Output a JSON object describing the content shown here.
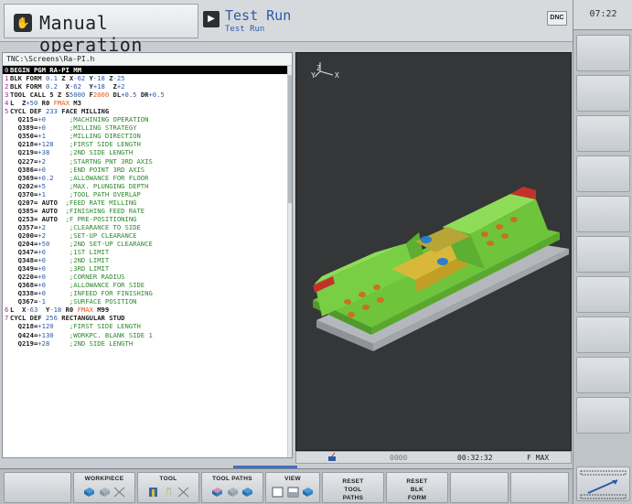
{
  "header": {
    "mode_title": "Manual operation",
    "sub_title": "Test Run",
    "sub_title_small": "Test Run",
    "dnc_label": "DNC",
    "clock": "07:22"
  },
  "program": {
    "path": "TNC:\\Screens\\Ra-PI.h",
    "lines": [
      {
        "n": "0",
        "text": "BEGIN PGM RA-PI MM",
        "selected": true
      },
      {
        "n": "1",
        "html": "BLK FORM <span class='num'>0.1</span> Z X<span class='num'>-62</span> Y<span class='num'>-18</span> Z<span class='num'>-25</span>"
      },
      {
        "n": "2",
        "html": "BLK FORM <span class='num'>0.2</span>  X<span class='num'>-62</span>  Y<span class='num'>+18</span>  Z<span class='num'>+2</span>"
      },
      {
        "n": "3",
        "html": "TOOL CALL 5 Z S<span class='num'>5000</span> F<span class='fmax'>2000</span> DL<span class='num'>+0.5</span> DR<span class='num'>+0.5</span>"
      },
      {
        "n": "4",
        "html": "L  Z<span class='num'>+50</span> R0 <span class='fmax'>FMAX</span> M3"
      },
      {
        "n": "5",
        "html": "CYCL DEF <span class='num'>233</span> FACE MILLING"
      },
      {
        "n": "",
        "html": "  Q215=<span class='num'>+0</span>      <span class='cmt'>;MACHINING OPERATION</span>"
      },
      {
        "n": "",
        "html": "  Q389=<span class='num'>+0</span>      <span class='cmt'>;MILLING STRATEGY</span>"
      },
      {
        "n": "",
        "html": "  Q350=<span class='num'>+1</span>      <span class='cmt'>;MILLING DIRECTION</span>"
      },
      {
        "n": "",
        "html": "  Q218=<span class='num'>+128</span>    <span class='cmt'>;FIRST SIDE LENGTH</span>"
      },
      {
        "n": "",
        "html": "  Q219=<span class='num'>+38</span>     <span class='cmt'>;2ND SIDE LENGTH</span>"
      },
      {
        "n": "",
        "html": "  Q227=<span class='num'>+2</span>      <span class='cmt'>;STARTNG PNT 3RD AXIS</span>"
      },
      {
        "n": "",
        "html": "  Q386=<span class='num'>+0</span>      <span class='cmt'>;END POINT 3RD AXIS</span>"
      },
      {
        "n": "",
        "html": "  Q369=<span class='num'>+0.2</span>    <span class='cmt'>;ALLOWANCE FOR FLOOR</span>"
      },
      {
        "n": "",
        "html": "  Q202=<span class='num'>+5</span>      <span class='cmt'>;MAX. PLUNGING DEPTH</span>"
      },
      {
        "n": "",
        "html": "  Q370=<span class='num'>+1</span>      <span class='cmt'>;TOOL PATH OVERLAP</span>"
      },
      {
        "n": "",
        "html": "  Q207= AUTO  <span class='cmt'>;FEED RATE MILLING</span>"
      },
      {
        "n": "",
        "html": "  Q385= AUTO  <span class='cmt'>;FINISHING FEED RATE</span>"
      },
      {
        "n": "",
        "html": "  Q253= AUTO  <span class='cmt'>;F PRE-POSITIONING</span>"
      },
      {
        "n": "",
        "html": "  Q357=<span class='num'>+2</span>      <span class='cmt'>;CLEARANCE TO SIDE</span>"
      },
      {
        "n": "",
        "html": "  Q200=<span class='num'>+2</span>      <span class='cmt'>;SET-UP CLEARANCE</span>"
      },
      {
        "n": "",
        "html": "  Q204=<span class='num'>+50</span>     <span class='cmt'>;2ND SET-UP CLEARANCE</span>"
      },
      {
        "n": "",
        "html": "  Q347=<span class='num'>+0</span>      <span class='cmt'>;1ST LIMIT</span>"
      },
      {
        "n": "",
        "html": "  Q348=<span class='num'>+0</span>      <span class='cmt'>;2ND LIMIT</span>"
      },
      {
        "n": "",
        "html": "  Q349=<span class='num'>+0</span>      <span class='cmt'>;3RD LIMIT</span>"
      },
      {
        "n": "",
        "html": "  Q220=<span class='num'>+0</span>      <span class='cmt'>;CORNER RADIUS</span>"
      },
      {
        "n": "",
        "html": "  Q368=<span class='num'>+0</span>      <span class='cmt'>;ALLOWANCE FOR SIDE</span>"
      },
      {
        "n": "",
        "html": "  Q338=<span class='num'>+0</span>      <span class='cmt'>;INFEED FOR FINISHING</span>"
      },
      {
        "n": "",
        "html": "  Q367=<span class='num'>-1</span>      <span class='cmt'>;SURFACE POSITION</span>"
      },
      {
        "n": "6",
        "html": "L  X<span class='num'>-63</span>  Y<span class='num'>-18</span> R0 <span class='fmax'>FMAX</span> M99"
      },
      {
        "n": "7",
        "html": "CYCL DEF <span class='num'>256</span> RECTANGULAR STUD"
      },
      {
        "n": "",
        "html": "  Q218=<span class='num'>+120</span>    <span class='cmt'>;FIRST SIDE LENGTH</span>"
      },
      {
        "n": "",
        "html": "  Q424=<span class='num'>+130</span>    <span class='cmt'>;WORKPC. BLANK SIDE 1</span>"
      },
      {
        "n": "",
        "html": "  Q219=<span class='num'>+28</span>     <span class='cmt'>;2ND SIDE LENGTH</span>"
      }
    ]
  },
  "graphics": {
    "axis_z": "Z",
    "axis_y": "Y",
    "axis_x": "X",
    "status_time": "00:32:32",
    "status_feed": "F MAX",
    "status_speed": "0000"
  },
  "softkeys": [
    {
      "label": "",
      "id": "sk-empty-1"
    },
    {
      "label": "WORKPIECE",
      "id": "sk-workpiece"
    },
    {
      "label": "TOOL",
      "id": "sk-tool"
    },
    {
      "label": "TOOL PATHS",
      "id": "sk-tool-paths"
    },
    {
      "label": "VIEW",
      "id": "sk-view"
    },
    {
      "label": "RESET TOOL PATHS",
      "id": "sk-reset-tool-paths"
    },
    {
      "label": "RESET BLK FORM",
      "id": "sk-reset-blk-form"
    },
    {
      "label": "",
      "id": "sk-empty-2"
    },
    {
      "label": "",
      "id": "sk-empty-3"
    }
  ],
  "colors": {
    "accent": "#3f6fc0",
    "part_green": "#6ec43a",
    "part_yellow": "#d9b73a",
    "part_red": "#c4312b",
    "hole_orange": "#c8711c",
    "hole_blue": "#2a7fc9"
  }
}
